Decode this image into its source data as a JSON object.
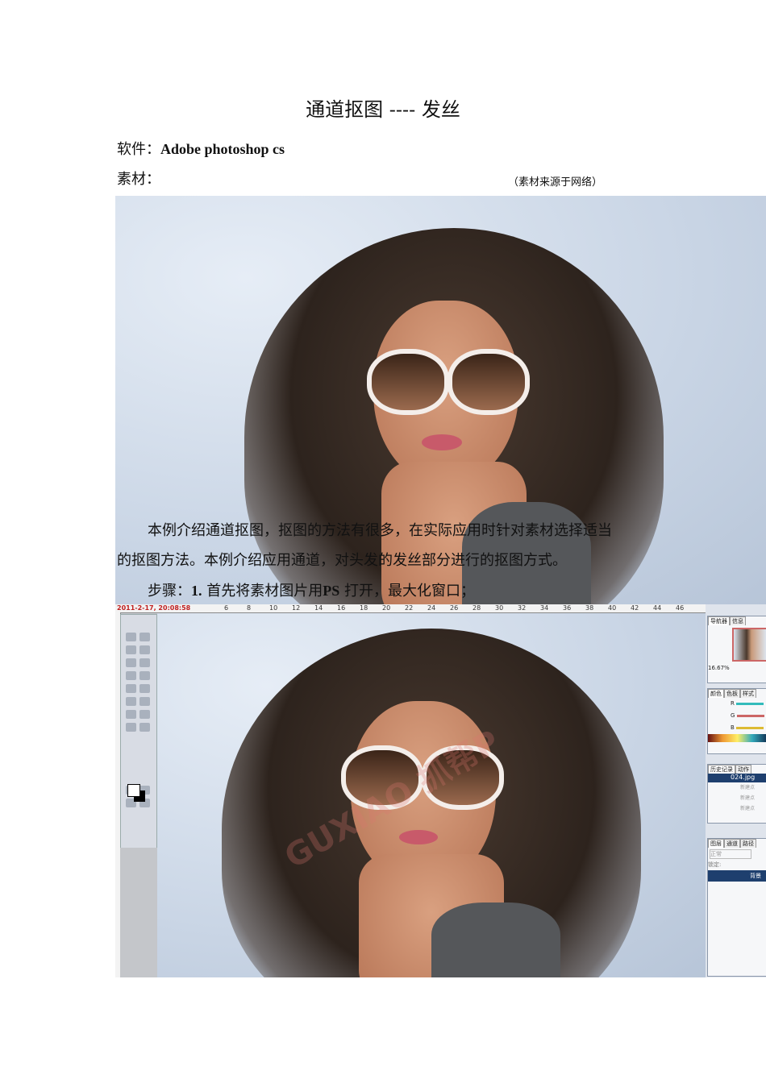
{
  "title": "通道抠图 ---- 发丝",
  "software": {
    "label": "软件：",
    "value": "Adobe photoshop cs"
  },
  "material": {
    "label": "素材：",
    "source_note": "（素材来源于网络）"
  },
  "intro": {
    "line1": "本例介绍通道抠图，抠图的方法有很多，在实际应用时针对素材选择适当",
    "line2": "的抠图方法。本例介绍应用通道，对头发的发丝部分进行的抠图方式。",
    "step_label": "步骤：",
    "step_num": "1.",
    "step_text_a": "首先将素材图片用",
    "step_ps": "PS",
    "step_text_b": "打开，最大化窗口；"
  },
  "screenshot": {
    "date": "2011-2-17, 20:08:58",
    "ruler_ticks": [
      "6",
      "8",
      "10",
      "12",
      "14",
      "16",
      "18",
      "20",
      "22",
      "24",
      "26",
      "28",
      "30",
      "32",
      "34",
      "36",
      "38",
      "40",
      "42",
      "44",
      "46"
    ],
    "watermark": "GUXIAO 抓帮P",
    "navigator": {
      "tabs": [
        "导航器",
        "信息"
      ],
      "zoom": "16.67%"
    },
    "color": {
      "tabs": [
        "颜色",
        "色板",
        "样式"
      ],
      "channels": [
        "R",
        "G",
        "B"
      ]
    },
    "history": {
      "tabs": [
        "历史记录",
        "动作"
      ],
      "file": "024.jpg",
      "items": [
        "新建点",
        "新建点",
        "新建点"
      ]
    },
    "layers": {
      "tabs": [
        "图层",
        "通道",
        "路径"
      ],
      "blend": "正常",
      "lock": "锁定:",
      "layer": "背景"
    }
  }
}
